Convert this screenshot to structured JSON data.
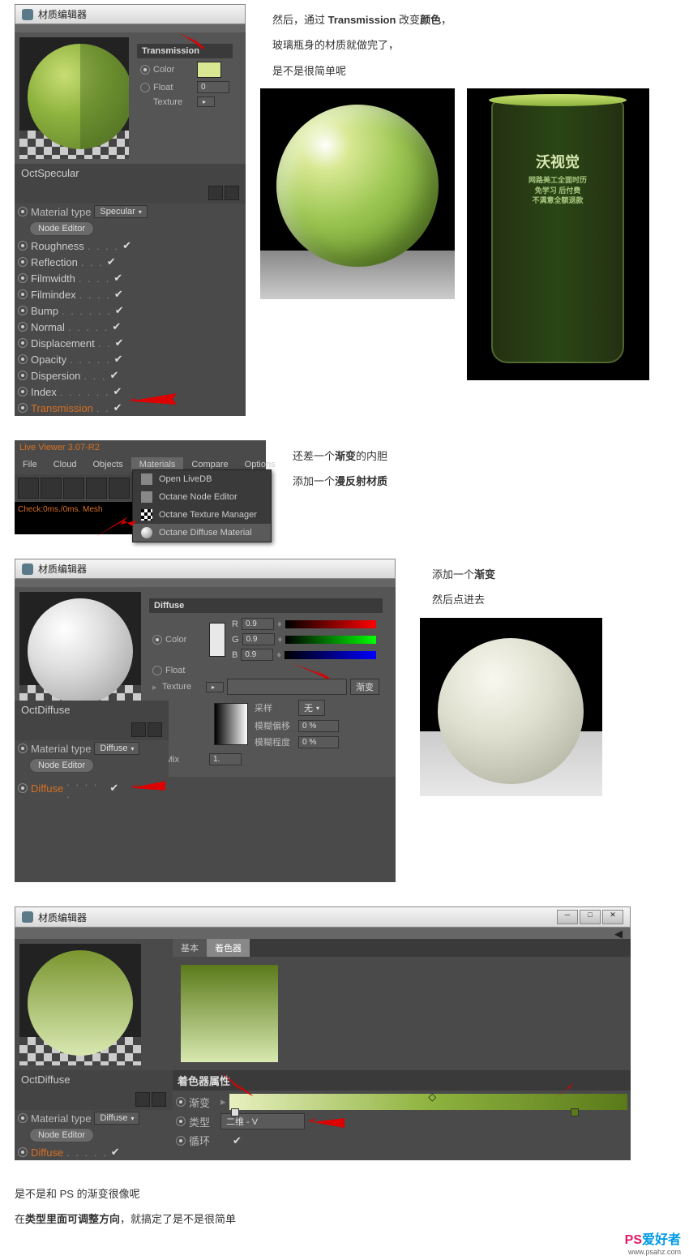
{
  "text1_a": "然后，通过 ",
  "text1_b": "Transmission",
  "text1_c": " 改变",
  "text1_d": "颜色",
  "text1_e": "，",
  "text2": "玻璃瓶身的材质就做完了，",
  "text3": "是不是很简单呢",
  "panel1": {
    "title": "材质编辑器",
    "name": "OctSpecular",
    "prop_header": "Transmission",
    "color_label": "Color",
    "float_label": "Float",
    "float_val": "0",
    "texture_label": "Texture",
    "mat_type_label": "Material type",
    "mat_type_val": "Specular",
    "node_editor": "Node Editor",
    "props": [
      "Roughness",
      "Reflection",
      "Filmwidth",
      "Filmindex",
      "Bump",
      "Normal",
      "Displacement",
      "Opacity",
      "Dispersion",
      "Index",
      "Transmission"
    ]
  },
  "bottle": {
    "title": "沃视觉",
    "sub1": "网路美工全面时历",
    "sub2": "免学习 后付费",
    "sub3": "不满意全额退款"
  },
  "text4_a": "还差一个",
  "text4_b": "渐变",
  "text4_c": "的内胆",
  "text5_a": "添加一个",
  "text5_b": "漫反射材质",
  "viewer": {
    "title": "Live Viewer 3.07-R2",
    "menus": [
      "File",
      "Cloud",
      "Objects",
      "Materials",
      "Compare",
      "Options"
    ],
    "status": "Check:0ms./0ms. Mesh",
    "items": [
      "Open LiveDB",
      "Octane Node Editor",
      "Octane Texture Manager",
      "Octane Diffuse Material"
    ]
  },
  "text6_a": "添加一个",
  "text6_b": "渐变",
  "text7": "然后点进去",
  "panel2": {
    "title": "材质编辑器",
    "name": "OctDiffuse",
    "header": "Diffuse",
    "color_label": "Color",
    "r": "R",
    "g": "G",
    "b": "B",
    "val": "0.9",
    "float_label": "Float",
    "texture_label": "Texture",
    "tex_val": "渐变",
    "sample": "采样",
    "sample_val": "无",
    "blur_off": "模糊偏移",
    "blur_off_val": "0 %",
    "blur_deg": "模糊程度",
    "blur_deg_val": "0 %",
    "mix": "Mix",
    "mix_val": "1.",
    "mat_type_label": "Material type",
    "mat_type_val": "Diffuse",
    "node_editor": "Node Editor",
    "diffuse_prop": "Diffuse"
  },
  "panel3": {
    "title": "材质编辑器",
    "name": "OctDiffuse",
    "tab1": "基本",
    "tab2": "着色器",
    "shader_props": "着色器属性",
    "grad": "渐变",
    "type": "类型",
    "type_val": "二维 - V",
    "cycle": "循环",
    "mat_type_label": "Material type",
    "mat_type_val": "Diffuse",
    "node_editor": "Node Editor",
    "diffuse_prop": "Diffuse"
  },
  "text8": "是不是和 PS 的渐变很像呢",
  "text9_a": "在",
  "text9_b": "类型里面可调整方向",
  "text9_c": "，就搞定了是不是很简单",
  "watermark": {
    "p": "PS",
    "s": "爱好者",
    "url": "www.psahz.com"
  }
}
